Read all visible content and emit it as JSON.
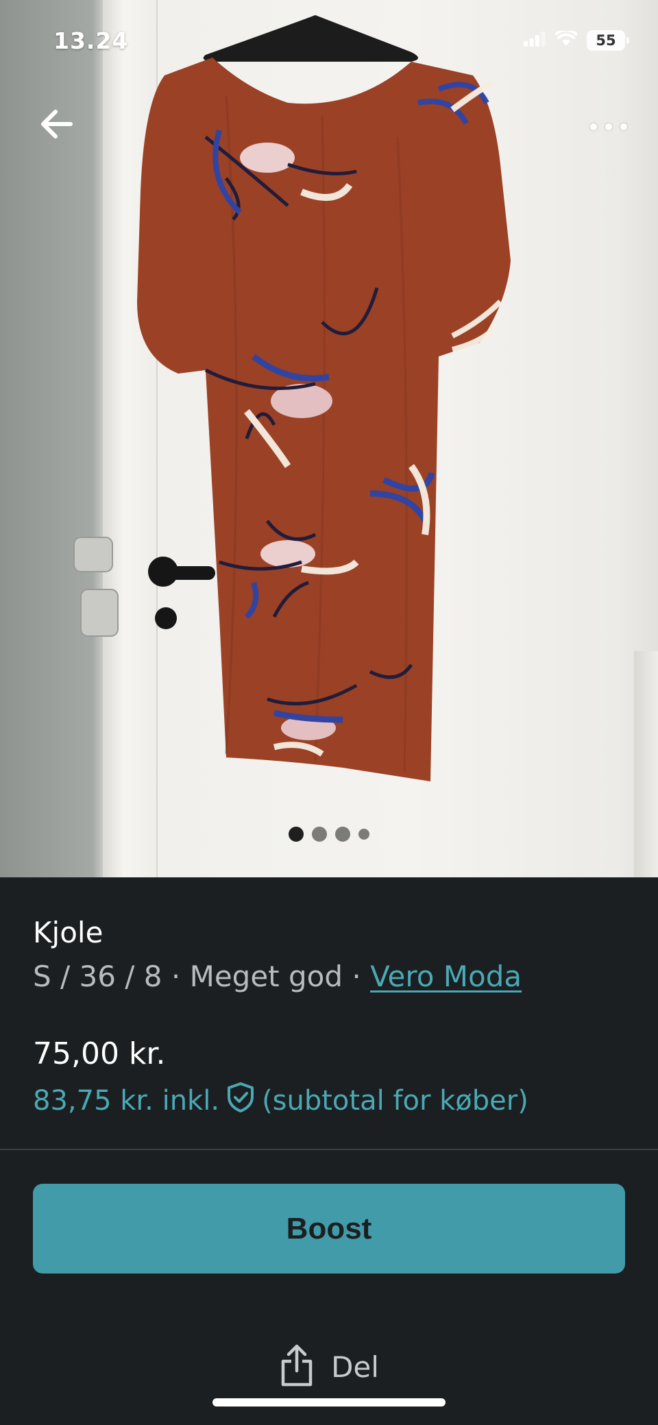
{
  "status_bar": {
    "time": "13.24",
    "battery": "55",
    "icons": [
      "cellular-signal-icon",
      "wifi-icon",
      "battery-icon"
    ]
  },
  "nav": {
    "back_icon": "arrow-left-icon",
    "more_icon": "ellipsis-icon"
  },
  "gallery": {
    "image_count": 4,
    "active_index": 0,
    "image_description": "Rust-brown short-sleeved midi dress with blue, white and pink floral print hanging on a hanger on a white door"
  },
  "listing": {
    "title": "Kjole",
    "size": "S / 36 / 8",
    "separator": " · ",
    "condition": "Meget god",
    "brand": "Vero Moda",
    "price": "75,00 kr.",
    "price_incl_prefix": "83,75 kr. inkl.",
    "price_incl_suffix": "(subtotal for køber)"
  },
  "actions": {
    "boost_label": "Boost",
    "share_label": "Del"
  },
  "colors": {
    "background": "#1b1f21",
    "accent": "#429ba8",
    "accent_text": "#4aa9b4",
    "secondary_text": "#b8bcbe"
  }
}
